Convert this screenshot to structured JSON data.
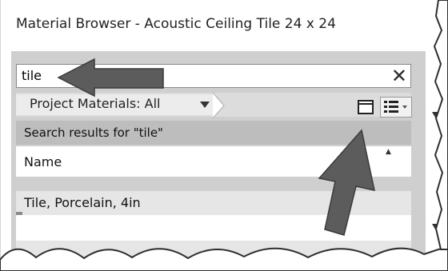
{
  "window": {
    "title": "Material Browser - Acoustic Ceiling Tile 24 x 24"
  },
  "search": {
    "value": "tile",
    "clear_glyph": "✕"
  },
  "toolbar": {
    "filter_label": "Project Materials: All"
  },
  "results": {
    "label": "Search results for \"tile\""
  },
  "list": {
    "column_header": "Name",
    "rows": [
      "Tile, Porcelain, 4in",
      "",
      ""
    ]
  },
  "icons": {
    "clear": "close-icon",
    "dropdown": "caret-down-icon",
    "view": "panel-view-icon",
    "list_view": "list-view-icon",
    "sort": "sort-up-icon"
  },
  "colors": {
    "arrow": "#5c5c5c",
    "panel": "#cfcfcf",
    "results_bar": "#bdbdbd"
  }
}
